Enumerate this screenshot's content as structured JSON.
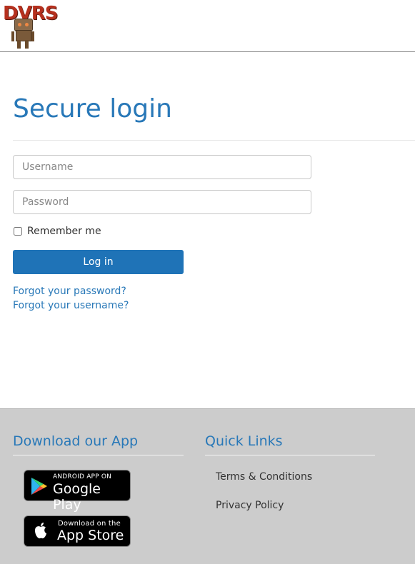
{
  "header": {
    "logo_text": "DVRS"
  },
  "login": {
    "title": "Secure login",
    "username_placeholder": "Username",
    "password_placeholder": "Password",
    "remember_label": "Remember me",
    "remember_checked": false,
    "login_button": "Log in",
    "forgot_password": "Forgot your password?",
    "forgot_username": "Forgot your username?"
  },
  "footer": {
    "app_title": "Download our App",
    "google_play": {
      "small": "ANDROID APP ON",
      "big": "Google Play"
    },
    "app_store": {
      "small": "Download on the",
      "big": "App Store"
    },
    "quick_links_title": "Quick Links",
    "quick_links": [
      "Terms & Conditions",
      "Privacy Policy"
    ]
  },
  "colors": {
    "accent": "#2878b8",
    "button": "#1f73b7",
    "footer_bg": "#cccccc"
  }
}
